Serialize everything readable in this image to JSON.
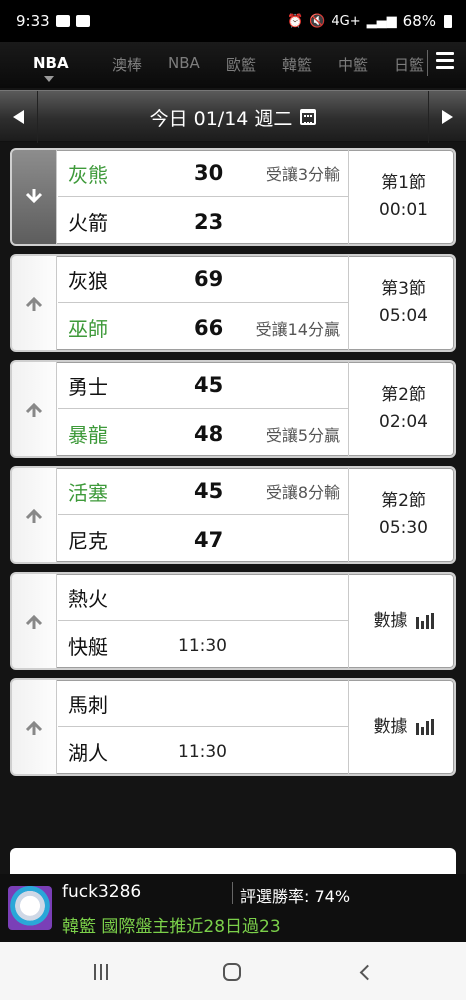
{
  "status_bar": {
    "time": "9:33",
    "signal_label": "4G+",
    "battery": "68%"
  },
  "league_tabs": [
    {
      "label": "NBA",
      "active": true
    },
    {
      "label": "澳棒",
      "active": false
    },
    {
      "label": "NBA",
      "active": false
    },
    {
      "label": "歐籃",
      "active": false
    },
    {
      "label": "韓籃",
      "active": false
    },
    {
      "label": "中籃",
      "active": false
    },
    {
      "label": "日籃",
      "active": false
    }
  ],
  "date_bar": {
    "label": "今日 01/14 週二"
  },
  "games": [
    {
      "home": {
        "name": "灰熊",
        "score": "30",
        "handicap": "受讓3分輸",
        "green": true
      },
      "away": {
        "name": "火箭",
        "score": "23",
        "handicap": "",
        "green": false
      },
      "status_line1": "第1節",
      "status_line2": "00:01",
      "expanded": true
    },
    {
      "home": {
        "name": "灰狼",
        "score": "69",
        "handicap": "",
        "green": false
      },
      "away": {
        "name": "巫師",
        "score": "66",
        "handicap": "受讓14分贏",
        "green": true
      },
      "status_line1": "第3節",
      "status_line2": "05:04",
      "expanded": false
    },
    {
      "home": {
        "name": "勇士",
        "score": "45",
        "handicap": "",
        "green": false
      },
      "away": {
        "name": "暴龍",
        "score": "48",
        "handicap": "受讓5分贏",
        "green": true
      },
      "status_line1": "第2節",
      "status_line2": "02:04",
      "expanded": false
    },
    {
      "home": {
        "name": "活塞",
        "score": "45",
        "handicap": "受讓8分輸",
        "green": true
      },
      "away": {
        "name": "尼克",
        "score": "47",
        "handicap": "",
        "green": false
      },
      "status_line1": "第2節",
      "status_line2": "05:30",
      "expanded": false
    },
    {
      "home": {
        "name": "熱火"
      },
      "away": {
        "name": "快艇",
        "time": "11:30"
      },
      "stats_label": "數據"
    },
    {
      "home": {
        "name": "馬刺"
      },
      "away": {
        "name": "湖人",
        "time": "11:30"
      },
      "stats_label": "數據"
    }
  ],
  "promo": {
    "username": "fuck3286",
    "win_rate": "評選勝率: 74%",
    "text": "韓籃 國際盤主推近28日過23"
  },
  "colors": {
    "accent_green": "#3e9a3a",
    "promo_green": "#7bd04a"
  }
}
